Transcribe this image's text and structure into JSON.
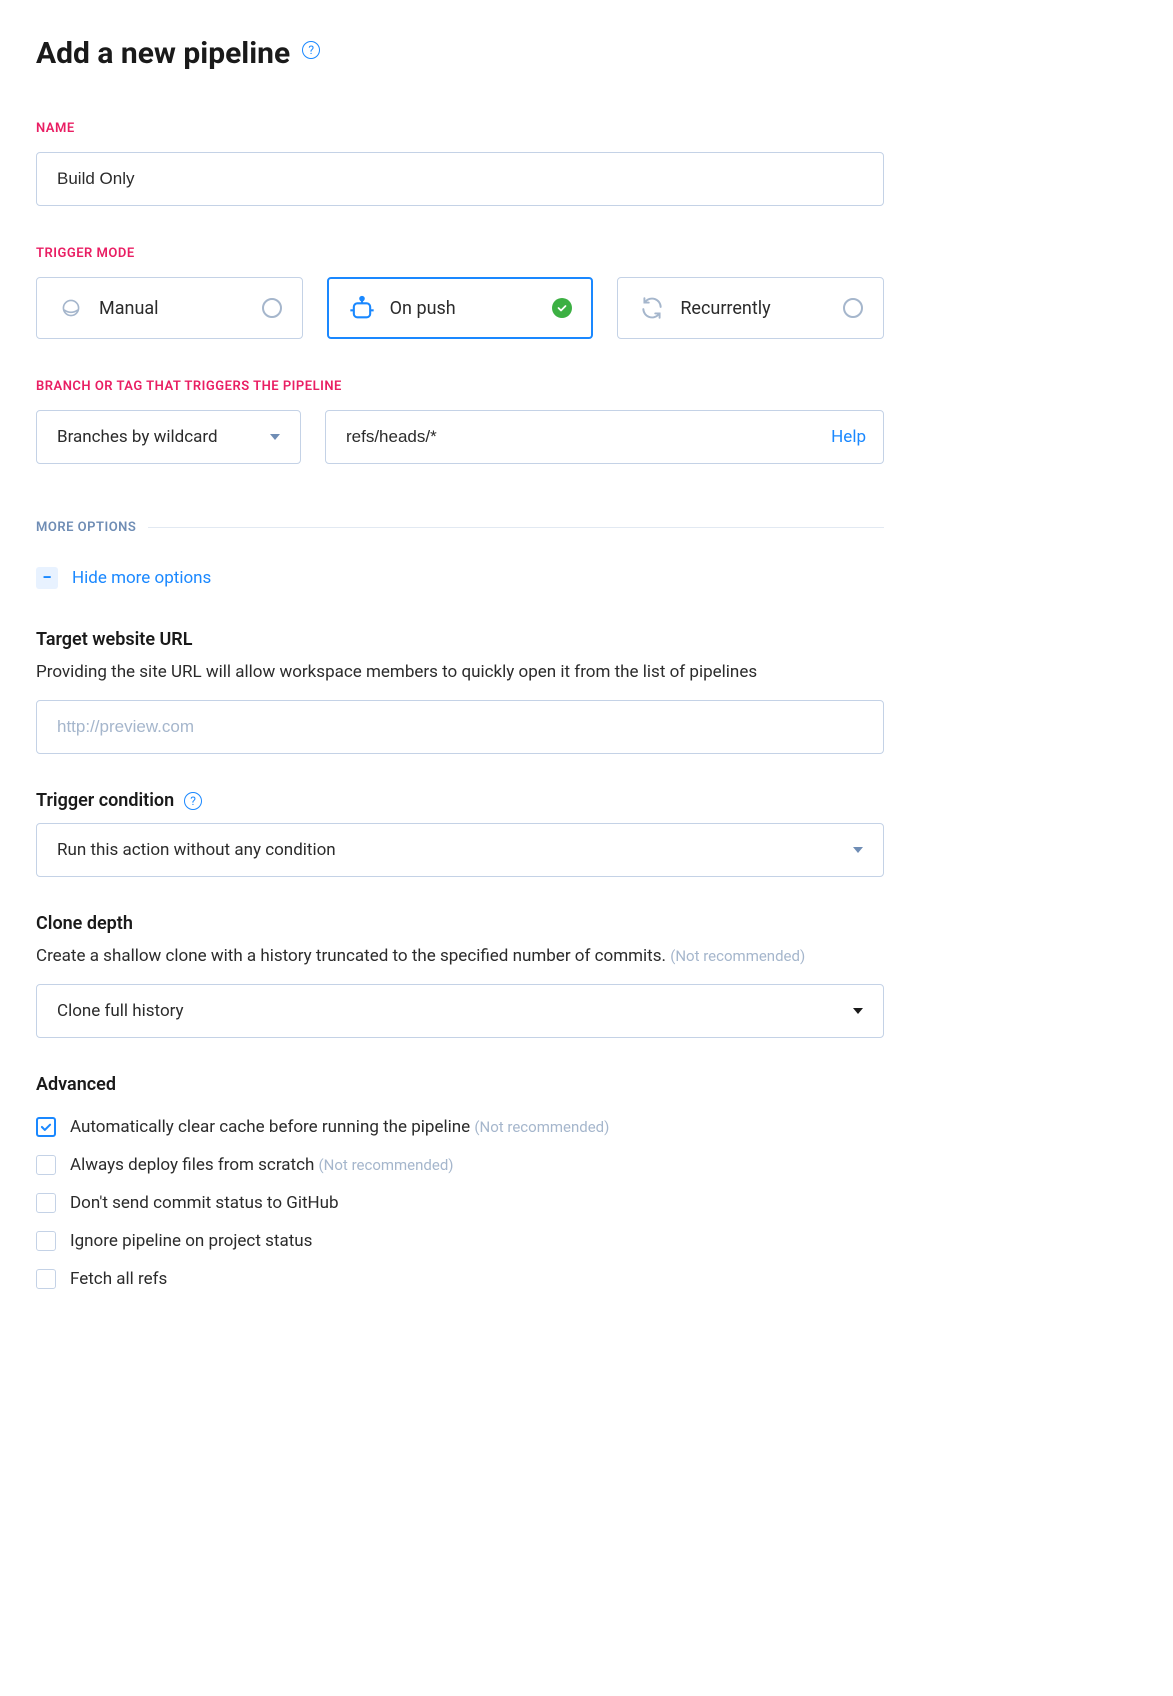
{
  "title": "Add a new pipeline",
  "name": {
    "label": "NAME",
    "value": "Build Only"
  },
  "trigger_mode": {
    "label": "TRIGGER MODE",
    "options": {
      "manual": "Manual",
      "on_push": "On push",
      "recurrently": "Recurrently"
    },
    "selected": "on_push"
  },
  "branch": {
    "label": "BRANCH OR TAG THAT TRIGGERS THE PIPELINE",
    "select_value": "Branches by wildcard",
    "input_value": "refs/heads/*",
    "help": "Help"
  },
  "more_options": {
    "label": "MORE OPTIONS",
    "hide_text": "Hide more options"
  },
  "target_url": {
    "heading": "Target website URL",
    "desc": "Providing the site URL will allow workspace members to quickly open it from the list of pipelines",
    "placeholder": "http://preview.com"
  },
  "trigger_condition": {
    "heading": "Trigger condition",
    "value": "Run this action without any condition"
  },
  "clone_depth": {
    "heading": "Clone depth",
    "desc": "Create a shallow clone with a history truncated to the specified number of commits.",
    "not_recommended": "(Not recommended)",
    "value": "Clone full history"
  },
  "advanced": {
    "heading": "Advanced",
    "options": [
      {
        "label": "Automatically clear cache before running the pipeline",
        "nr": "(Not recommended)",
        "checked": true
      },
      {
        "label": "Always deploy files from scratch",
        "nr": "(Not recommended)",
        "checked": false
      },
      {
        "label": "Don't send commit status to GitHub",
        "nr": "",
        "checked": false
      },
      {
        "label": "Ignore pipeline on project status",
        "nr": "",
        "checked": false
      },
      {
        "label": "Fetch all refs",
        "nr": "",
        "checked": false
      }
    ]
  }
}
